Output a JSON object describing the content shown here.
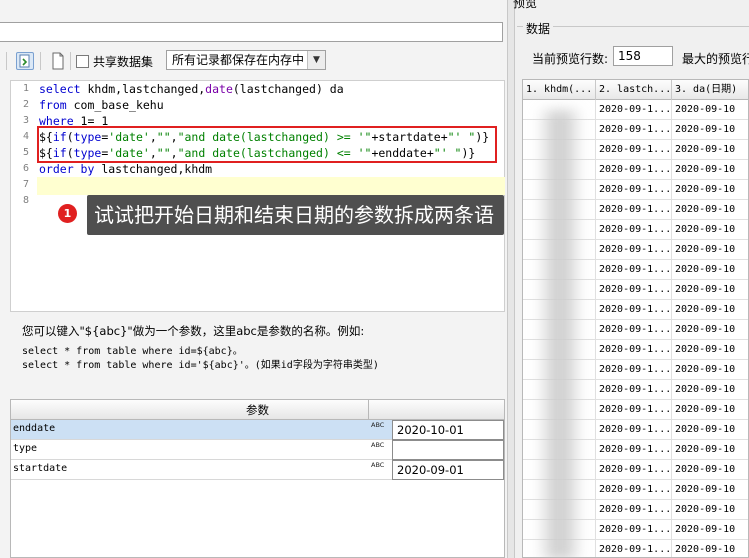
{
  "toolbar": {
    "share_label": "共享数据集",
    "memory_combo_value": "所有记录都保存在内存中"
  },
  "editor": {
    "lines": [
      {
        "num": "1",
        "parts": [
          [
            "kw",
            "select"
          ],
          [
            "plain",
            " khdm,lastchanged,"
          ],
          [
            "fn",
            "date"
          ],
          [
            "plain",
            "(lastchanged) da"
          ]
        ]
      },
      {
        "num": "2",
        "parts": [
          [
            "kw",
            "from"
          ],
          [
            "plain",
            " com_base_kehu"
          ]
        ]
      },
      {
        "num": "3",
        "parts": [
          [
            "kw",
            "where"
          ],
          [
            "plain",
            " 1= 1"
          ]
        ]
      },
      {
        "num": "4",
        "parts": [
          [
            "plain",
            "${"
          ],
          [
            "kw",
            "if"
          ],
          [
            "plain",
            "("
          ],
          [
            "kw",
            "type"
          ],
          [
            "plain",
            "="
          ],
          [
            "str",
            "'date'"
          ],
          [
            "plain",
            ","
          ],
          [
            "str",
            "\"\""
          ],
          [
            "plain",
            ","
          ],
          [
            "str",
            "\"and date(lastchanged) >= '\""
          ],
          [
            "plain",
            "+startdate+"
          ],
          [
            "str",
            "\"' \""
          ],
          [
            "plain",
            ")}"
          ]
        ]
      },
      {
        "num": "5",
        "parts": [
          [
            "plain",
            "${"
          ],
          [
            "kw",
            "if"
          ],
          [
            "plain",
            "("
          ],
          [
            "kw",
            "type"
          ],
          [
            "plain",
            "="
          ],
          [
            "str",
            "'date'"
          ],
          [
            "plain",
            ","
          ],
          [
            "str",
            "\"\""
          ],
          [
            "plain",
            ","
          ],
          [
            "str",
            "\"and date(lastchanged) <= '\""
          ],
          [
            "plain",
            "+enddate+"
          ],
          [
            "str",
            "\"' \""
          ],
          [
            "plain",
            ")}"
          ]
        ]
      },
      {
        "num": "6",
        "parts": [
          [
            "kw",
            "order by"
          ],
          [
            "plain",
            " lastchanged,khdm"
          ]
        ]
      },
      {
        "num": "7",
        "parts": []
      },
      {
        "num": "8",
        "parts": []
      }
    ]
  },
  "annotation": {
    "badge": "1",
    "text": "试试把开始日期和结束日期的参数拆成两条语句写"
  },
  "help": {
    "line1": "您可以键入\"${abc}\"做为一个参数，这里abc是参数的名称。例如:",
    "line2": "select * from table where id=${abc}。",
    "line3": "select * from table where id='${abc}'。(如果id字段为字符串类型)"
  },
  "params": {
    "header": "参数",
    "type_icon_text": "ABC",
    "rows": [
      {
        "name": "enddate",
        "value": "2020-10-01",
        "selected": true
      },
      {
        "name": "type",
        "value": "",
        "selected": false
      },
      {
        "name": "startdate",
        "value": "2020-09-01",
        "selected": false
      }
    ]
  },
  "preview": {
    "title": "预览",
    "group_label": "数据",
    "rowcount_label": "当前预览行数:",
    "rowcount_value": "158",
    "maxrow_label": "最大的预览行",
    "columns": [
      "1. khdm(...",
      "2. lastch...",
      "3. da(日期)"
    ],
    "rows": [
      [
        "",
        "2020-09-1...",
        "2020-09-10"
      ],
      [
        "",
        "2020-09-1...",
        "2020-09-10"
      ],
      [
        "",
        "2020-09-1...",
        "2020-09-10"
      ],
      [
        "",
        "2020-09-1...",
        "2020-09-10"
      ],
      [
        "",
        "2020-09-1...",
        "2020-09-10"
      ],
      [
        "",
        "2020-09-1...",
        "2020-09-10"
      ],
      [
        "",
        "2020-09-1...",
        "2020-09-10"
      ],
      [
        "",
        "2020-09-1...",
        "2020-09-10"
      ],
      [
        "",
        "2020-09-1...",
        "2020-09-10"
      ],
      [
        "",
        "2020-09-1...",
        "2020-09-10"
      ],
      [
        "",
        "2020-09-1...",
        "2020-09-10"
      ],
      [
        "",
        "2020-09-1...",
        "2020-09-10"
      ],
      [
        "",
        "2020-09-1...",
        "2020-09-10"
      ],
      [
        "",
        "2020-09-1...",
        "2020-09-10"
      ],
      [
        "",
        "2020-09-1...",
        "2020-09-10"
      ],
      [
        "",
        "2020-09-1...",
        "2020-09-10"
      ],
      [
        "",
        "2020-09-1...",
        "2020-09-10"
      ],
      [
        "",
        "2020-09-1...",
        "2020-09-10"
      ],
      [
        "",
        "2020-09-1...",
        "2020-09-10"
      ],
      [
        "",
        "2020-09-1...",
        "2020-09-10"
      ],
      [
        "",
        "2020-09-1...",
        "2020-09-10"
      ],
      [
        "",
        "2020-09-1...",
        "2020-09-10"
      ],
      [
        "",
        "2020-09-1...",
        "2020-09-10"
      ]
    ]
  }
}
